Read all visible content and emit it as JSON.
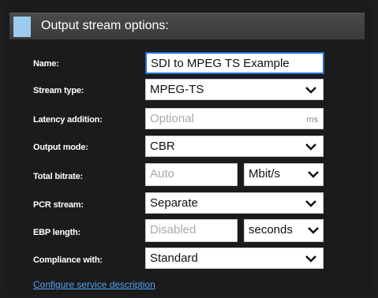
{
  "header": {
    "title": "Output stream options:"
  },
  "rows": {
    "name": {
      "label": "Name:",
      "value": "SDI to MPEG TS Example"
    },
    "stream_type": {
      "label": "Stream type:",
      "value": "MPEG-TS"
    },
    "latency": {
      "label": "Latency addition:",
      "placeholder": "Optional",
      "unit": "ms"
    },
    "output_mode": {
      "label": "Output mode:",
      "value": "CBR"
    },
    "total_bitrate": {
      "label": "Total bitrate:",
      "placeholder": "Auto",
      "unit_value": "Mbit/s"
    },
    "pcr_stream": {
      "label": "PCR stream:",
      "value": "Separate"
    },
    "ebp_length": {
      "label": "EBP length:",
      "placeholder": "Disabled",
      "unit_value": "seconds"
    },
    "compliance": {
      "label": "Compliance with:",
      "value": "Standard"
    }
  },
  "link": {
    "label": "Configure service description"
  },
  "colors": {
    "accent": "#9ccbee",
    "link": "#4ea4f2",
    "focus": "#1f6ed4"
  }
}
